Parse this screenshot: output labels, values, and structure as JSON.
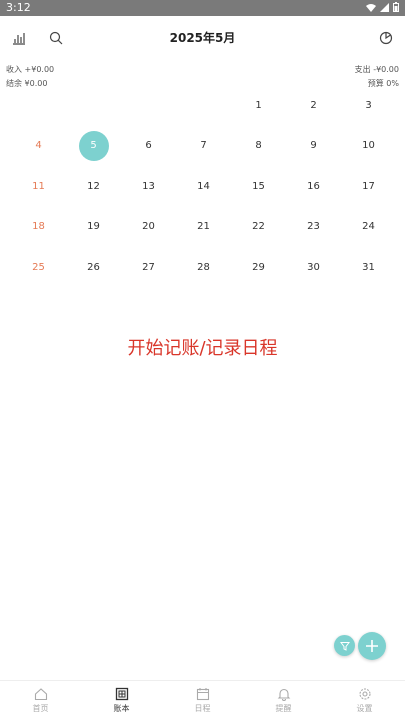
{
  "status": {
    "time": "3:12"
  },
  "header": {
    "title": "2025年5月",
    "left_icons": [
      "chart-icon",
      "search-icon"
    ],
    "right_icon": "pie-chart-icon"
  },
  "summary": {
    "income": "收入 +¥0.00",
    "balance": "结余 ¥0.00",
    "expense": "支出 -¥0.00",
    "budget": "预算 0%"
  },
  "calendar": {
    "weeks": [
      [
        "",
        "",
        "",
        "",
        "1",
        "2",
        "3"
      ],
      [
        "4",
        "5",
        "6",
        "7",
        "8",
        "9",
        "10"
      ],
      [
        "11",
        "12",
        "13",
        "14",
        "15",
        "16",
        "17"
      ],
      [
        "18",
        "19",
        "20",
        "21",
        "22",
        "23",
        "24"
      ],
      [
        "25",
        "26",
        "27",
        "28",
        "29",
        "30",
        "31"
      ]
    ],
    "today": "5"
  },
  "empty_prompt": "开始记账/记录日程",
  "bottom_nav": [
    {
      "label": "首页",
      "icon": "home-icon"
    },
    {
      "label": "账本",
      "icon": "ledger-icon",
      "active": true
    },
    {
      "label": "日程",
      "icon": "calendar-icon"
    },
    {
      "label": "提醒",
      "icon": "bell-icon"
    },
    {
      "label": "设置",
      "icon": "gear-icon"
    }
  ],
  "colors": {
    "accent": "#7dd1cf",
    "weekend": "#e57a55",
    "prompt": "#d9362a"
  }
}
